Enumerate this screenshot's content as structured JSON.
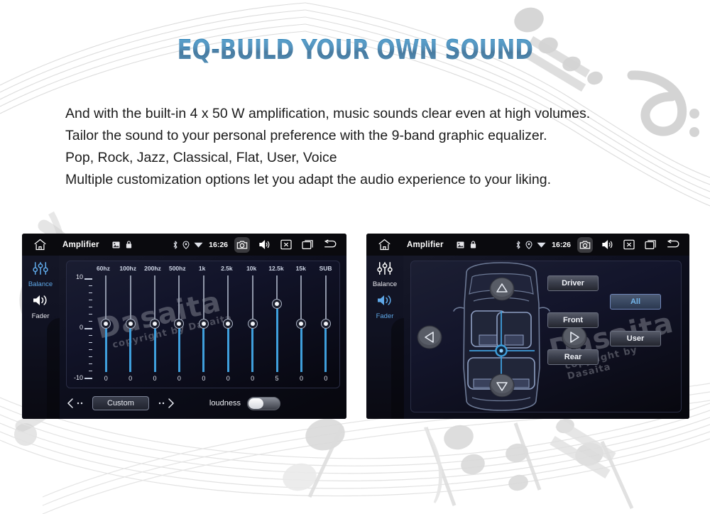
{
  "page": {
    "title": "EQ-BUILD YOUR OWN SOUND",
    "accent_color": "#1b6fa8",
    "background_color": "#ffffff"
  },
  "body_lines": [
    "And with the built-in 4 x 50 W amplification, music sounds clear even at high volumes.",
    "Tailor the sound to your personal preference with the 9-band graphic equalizer.",
    "Pop, Rock, Jazz, Classical, Flat, User, Voice",
    "Multiple customization options let you adapt the audio experience to your liking."
  ],
  "watermark": {
    "brand": "Dasaita",
    "copyright": "copyright by Dasaita"
  },
  "statusbar": {
    "home_icon": "home-icon",
    "title": "Amplifier",
    "mini_icons": [
      "image-icon",
      "lock-icon"
    ],
    "indicator_icons": [
      "bluetooth-icon",
      "location-icon",
      "wifi-icon"
    ],
    "time": "16:26",
    "action_icons": [
      "camera-icon",
      "volume-icon",
      "close-box-icon",
      "recents-icon",
      "back-icon"
    ]
  },
  "eq_screen": {
    "rail": {
      "balance": {
        "label": "Balance",
        "icon": "equalizer-icon",
        "active": true
      },
      "fader": {
        "label": "Fader",
        "icon": "speaker-icon",
        "active": false
      }
    },
    "scale_labels": {
      "top": "10",
      "mid": "0",
      "bottom": "-10"
    },
    "bands": [
      {
        "label": "60hz",
        "value": "0"
      },
      {
        "label": "100hz",
        "value": "0"
      },
      {
        "label": "200hz",
        "value": "0"
      },
      {
        "label": "500hz",
        "value": "0"
      },
      {
        "label": "1k",
        "value": "0"
      },
      {
        "label": "2.5k",
        "value": "0"
      },
      {
        "label": "10k",
        "value": "0"
      },
      {
        "label": "12.5k",
        "value": "5"
      },
      {
        "label": "15k",
        "value": "0"
      },
      {
        "label": "SUB",
        "value": "0"
      }
    ],
    "bottom_bar": {
      "prev_icon": "chevron-left-icon",
      "preset_label": "Custom",
      "next_icon": "chevron-right-icon",
      "loudness_label": "loudness",
      "loudness_on": false
    }
  },
  "fader_screen": {
    "rail": {
      "balance": {
        "label": "Balance",
        "icon": "equalizer-icon",
        "active": false
      },
      "fader": {
        "label": "Fader",
        "icon": "speaker-icon",
        "active": true
      }
    },
    "car": {
      "up_icon": "arrow-up-icon",
      "down_icon": "arrow-down-icon",
      "left_icon": "arrow-left-icon",
      "right_icon": "arrow-right-icon",
      "position_icon": "position-crosshair-icon"
    },
    "presets": [
      {
        "label": "Driver",
        "active": false
      },
      {
        "label": "Front",
        "active": false
      },
      {
        "label": "Rear",
        "active": false
      },
      {
        "label": "All",
        "active": true
      },
      {
        "label": "User",
        "active": false
      }
    ]
  }
}
